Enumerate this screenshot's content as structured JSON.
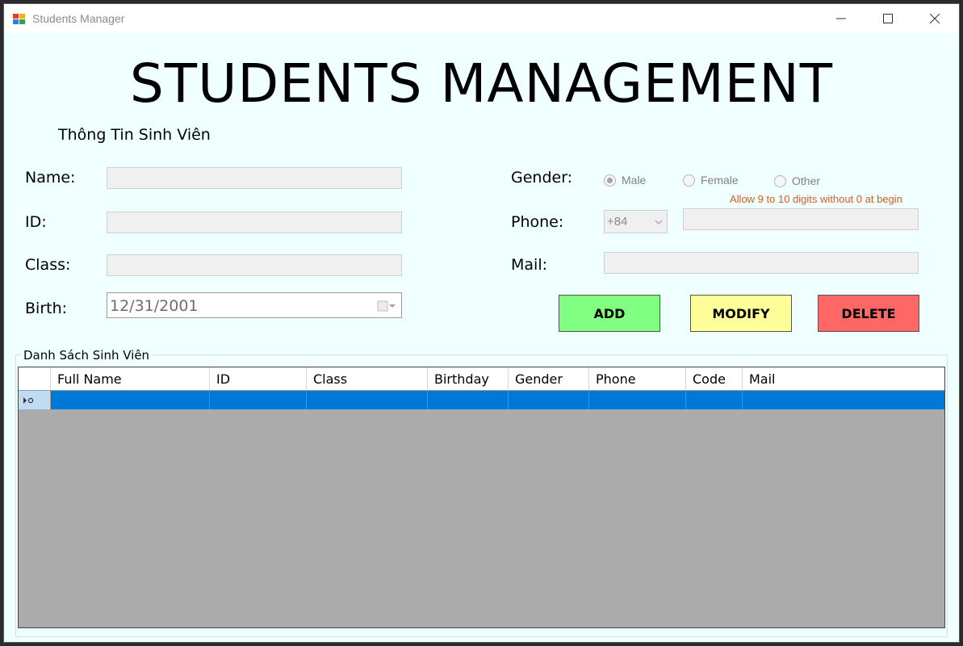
{
  "window": {
    "title": "Students Manager"
  },
  "heading": "STUDENTS MANAGEMENT",
  "section_title": "Thông Tin Sinh Viên",
  "form": {
    "name_label": "Name:",
    "id_label": "ID:",
    "class_label": "Class:",
    "birth_label": "Birth:",
    "birth_value": "12/31/2001",
    "gender_label": "Gender:",
    "gender_options": [
      "Male",
      "Female",
      "Other"
    ],
    "gender_selected": "Male",
    "phone_label": "Phone:",
    "phone_prefix": "+84",
    "phone_hint": "Allow 9 to 10 digits without 0 at begin",
    "mail_label": "Mail:"
  },
  "buttons": {
    "add": "ADD",
    "modify": "MODIFY",
    "delete": "DELETE"
  },
  "colors": {
    "add": "#80ff80",
    "modify": "#ffff99",
    "delete": "#ff6666",
    "selection": "#0078d7",
    "grid_bg": "#ababab"
  },
  "list": {
    "title": "Danh Sách Sinh Viên",
    "columns": [
      "Full Name",
      "ID",
      "Class",
      "Birthday",
      "Gender",
      "Phone",
      "Code",
      "Mail"
    ]
  }
}
